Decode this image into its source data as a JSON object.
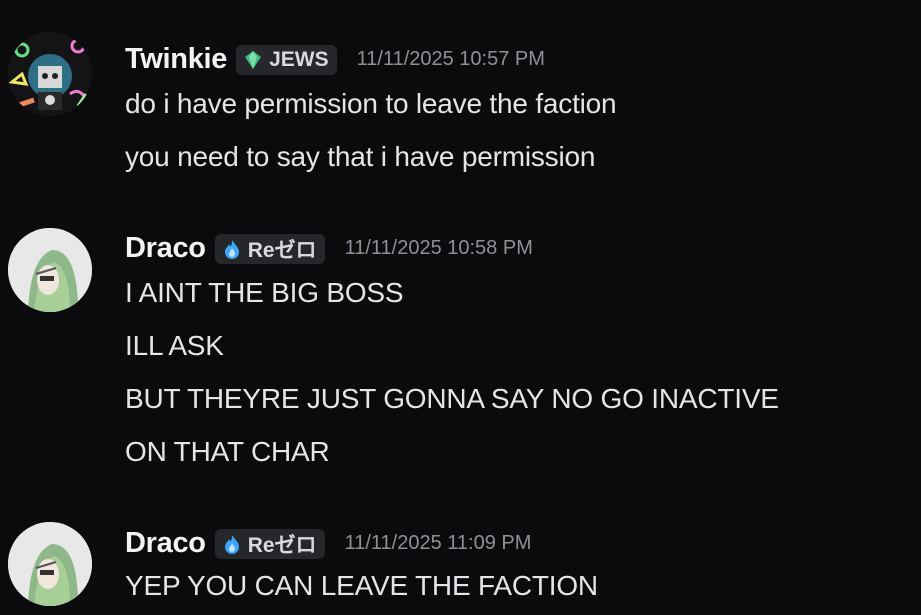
{
  "messages": [
    {
      "username": "Twinkie",
      "tag": {
        "icon": "tag-gem-icon",
        "label": "JEWS",
        "color": "#43b581"
      },
      "timestamp": "11/11/2025 10:57 PM",
      "lines": [
        "do i have permission to leave the faction",
        "you need to say that i have permission"
      ]
    },
    {
      "username": "Draco",
      "tag": {
        "icon": "flame-icon",
        "label": "Reゼロ",
        "color": "#3ba5ff"
      },
      "timestamp": "11/11/2025 10:58 PM",
      "lines": [
        "I AINT THE BIG BOSS",
        "ILL ASK",
        "BUT THEYRE JUST GONNA SAY NO GO INACTIVE",
        "ON THAT CHAR"
      ]
    },
    {
      "username": "Draco",
      "tag": {
        "icon": "flame-icon",
        "label": "Reゼロ",
        "color": "#3ba5ff"
      },
      "timestamp": "11/11/2025 11:09 PM",
      "lines": [
        "YEP  YOU  CAN LEAVE  THE  FACTION"
      ]
    }
  ]
}
